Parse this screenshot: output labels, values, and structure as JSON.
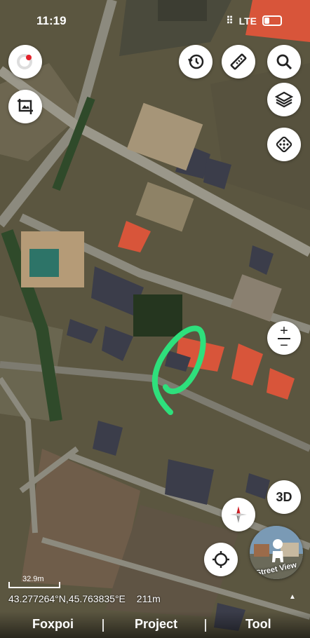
{
  "status_bar": {
    "time": "11:19",
    "network": "LTE"
  },
  "map": {
    "scale_label": "32.9m",
    "coordinates": "43.277264°N,45.763835°E",
    "altitude": "211m"
  },
  "controls": {
    "zoom_plus": "+",
    "zoom_minus": "−",
    "three_d": "3D",
    "street_view": "Street View"
  },
  "bottom_nav": {
    "tabs": [
      "Foxpoi",
      "Project",
      "Tool"
    ]
  },
  "colors": {
    "marker": "#2ee07c",
    "roof_red": "#d8553a",
    "roof_dark": "#3b3d4a"
  }
}
